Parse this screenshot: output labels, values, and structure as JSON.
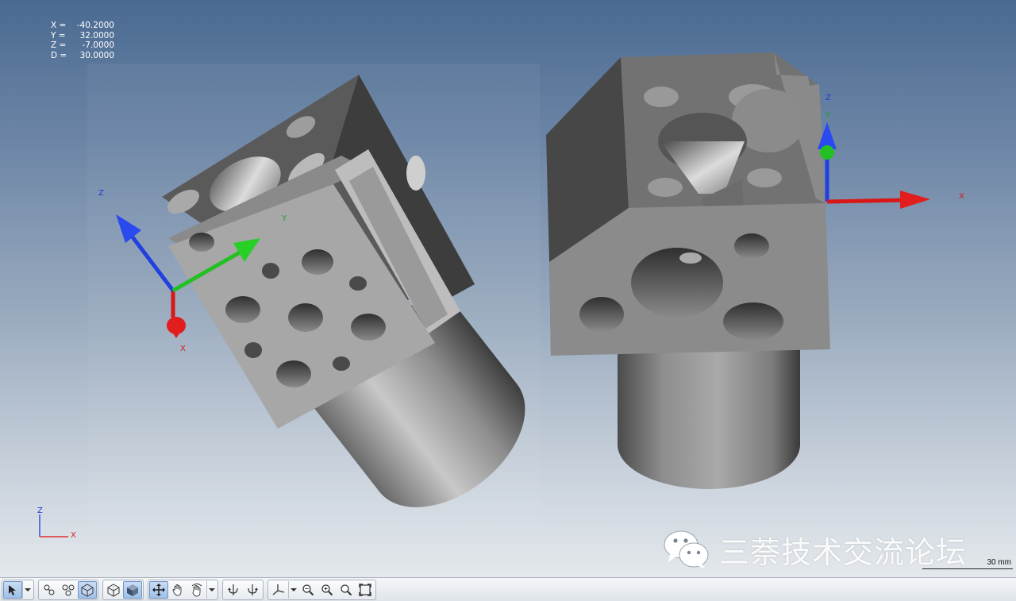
{
  "coordinates": {
    "x_label": "X =",
    "x_value": "-40.2000",
    "y_label": "Y =",
    "y_value": "32.0000",
    "z_label": "Z =",
    "z_value": "-7.0000",
    "d_label": "D =",
    "d_value": "30.0000"
  },
  "axes": {
    "model_left": {
      "x": "X",
      "y": "Y",
      "z": "Z"
    },
    "model_right": {
      "x": "X",
      "y": "Y",
      "z": "Z"
    },
    "corner": {
      "x": "X",
      "z": "Z"
    },
    "colors": {
      "x": "#e02020",
      "y": "#20c020",
      "z": "#2040e0"
    }
  },
  "watermark": {
    "text": "三萘技术交流论坛",
    "icon": "wechat-icon"
  },
  "scale_bar": {
    "label": "30 mm"
  },
  "toolbar": {
    "groups": [
      {
        "buttons": [
          {
            "icon": "select-cursor-icon",
            "active": true
          },
          {
            "icon": "dropdown-arrow-icon"
          }
        ]
      },
      {
        "buttons": [
          {
            "icon": "measure-angle-icon"
          },
          {
            "icon": "measure-distance-icon"
          },
          {
            "icon": "shaded-mode-icon",
            "active": true
          }
        ]
      },
      {
        "buttons": [
          {
            "icon": "wireframe-cube-icon"
          },
          {
            "icon": "solid-cube-icon",
            "active": true
          }
        ]
      },
      {
        "buttons": [
          {
            "icon": "pan-move-icon",
            "active": true
          },
          {
            "icon": "hand-grab-icon"
          },
          {
            "icon": "hand-rotate-icon"
          },
          {
            "icon": "dropdown-arrow-icon"
          }
        ]
      },
      {
        "buttons": [
          {
            "icon": "rotate-left-icon"
          },
          {
            "icon": "rotate-right-icon"
          }
        ]
      },
      {
        "buttons": [
          {
            "icon": "axis-triad-icon"
          },
          {
            "icon": "dropdown-arrow-icon"
          },
          {
            "icon": "zoom-out-icon"
          },
          {
            "icon": "zoom-in-icon"
          },
          {
            "icon": "zoom-window-icon"
          },
          {
            "icon": "zoom-fit-icon"
          }
        ]
      }
    ]
  }
}
